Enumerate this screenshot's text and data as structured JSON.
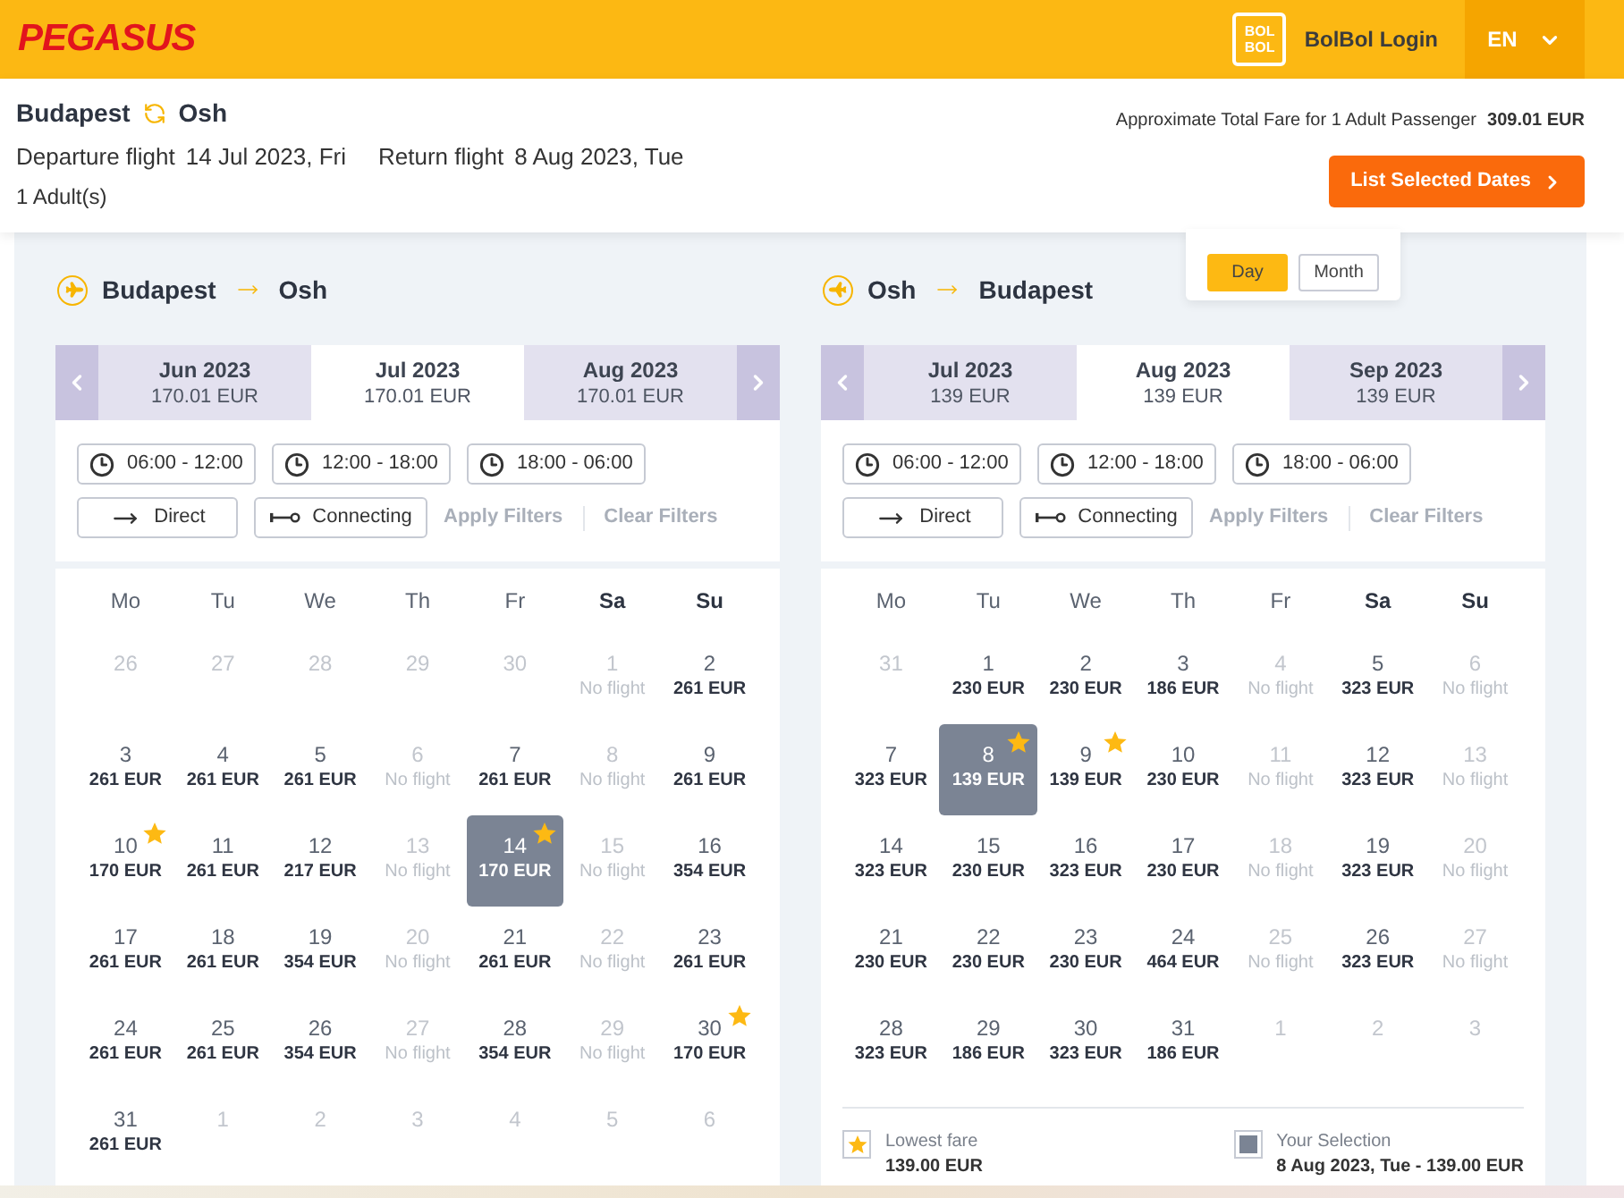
{
  "header": {
    "logo": "PEGASUS",
    "bolbol_badge": [
      "BOL",
      "BOL"
    ],
    "login": "BolBol Login",
    "language": "EN"
  },
  "summary": {
    "origin": "Budapest",
    "destination": "Osh",
    "departure_label": "Departure flight",
    "departure_date": "14 Jul 2023, Fri",
    "return_label": "Return flight",
    "return_date": "8 Aug 2023, Tue",
    "passengers": "1 Adult(s)",
    "fare_label": "Approximate Total Fare for 1 Adult Passenger",
    "fare_total": "309.01 EUR",
    "list_button": "List Selected Dates"
  },
  "view_toggle": [
    {
      "label": "Day",
      "selected": true
    },
    {
      "label": "Month",
      "selected": false
    }
  ],
  "legs": [
    {
      "kind": "outbound",
      "from": "Budapest",
      "to": "Osh",
      "months": [
        {
          "label": "Jun 2023",
          "price": "170.01 EUR",
          "selected": false
        },
        {
          "label": "Jul 2023",
          "price": "170.01 EUR",
          "selected": true
        },
        {
          "label": "Aug 2023",
          "price": "170.01 EUR",
          "selected": false
        }
      ],
      "time_filters": [
        "06:00 - 12:00",
        "12:00 - 18:00",
        "18:00 - 06:00"
      ],
      "stop_filters": [
        {
          "kind": "direct",
          "label": "Direct"
        },
        {
          "kind": "connecting",
          "label": "Connecting"
        }
      ],
      "actions": [
        {
          "label": "Apply Filters",
          "disabled": true
        },
        {
          "label": "Clear Filters",
          "disabled": true
        }
      ],
      "weekdays": [
        {
          "label": "Mo",
          "weekend": false
        },
        {
          "label": "Tu",
          "weekend": false
        },
        {
          "label": "We",
          "weekend": false
        },
        {
          "label": "Th",
          "weekend": false
        },
        {
          "label": "Fr",
          "weekend": false
        },
        {
          "label": "Sa",
          "weekend": true
        },
        {
          "label": "Su",
          "weekend": true
        }
      ],
      "days": [
        {
          "day": "26",
          "kind": "outside",
          "selected": false,
          "lowest": false
        },
        {
          "day": "27",
          "kind": "outside",
          "selected": false,
          "lowest": false
        },
        {
          "day": "28",
          "kind": "outside",
          "selected": false,
          "lowest": false
        },
        {
          "day": "29",
          "kind": "outside",
          "selected": false,
          "lowest": false
        },
        {
          "day": "30",
          "kind": "outside",
          "selected": false,
          "lowest": false
        },
        {
          "day": "1",
          "kind": "no-flight",
          "price": "No flight",
          "selected": false,
          "lowest": false
        },
        {
          "day": "2",
          "kind": "fare",
          "price": "261 EUR",
          "selected": false,
          "lowest": false
        },
        {
          "day": "3",
          "kind": "fare",
          "price": "261 EUR",
          "selected": false,
          "lowest": false
        },
        {
          "day": "4",
          "kind": "fare",
          "price": "261 EUR",
          "selected": false,
          "lowest": false
        },
        {
          "day": "5",
          "kind": "fare",
          "price": "261 EUR",
          "selected": false,
          "lowest": false
        },
        {
          "day": "6",
          "kind": "no-flight",
          "price": "No flight",
          "selected": false,
          "lowest": false
        },
        {
          "day": "7",
          "kind": "fare",
          "price": "261 EUR",
          "selected": false,
          "lowest": false
        },
        {
          "day": "8",
          "kind": "no-flight",
          "price": "No flight",
          "selected": false,
          "lowest": false
        },
        {
          "day": "9",
          "kind": "fare",
          "price": "261 EUR",
          "selected": false,
          "lowest": false
        },
        {
          "day": "10",
          "kind": "fare",
          "price": "170 EUR",
          "selected": false,
          "lowest": true
        },
        {
          "day": "11",
          "kind": "fare",
          "price": "261 EUR",
          "selected": false,
          "lowest": false
        },
        {
          "day": "12",
          "kind": "fare",
          "price": "217 EUR",
          "selected": false,
          "lowest": false
        },
        {
          "day": "13",
          "kind": "no-flight",
          "price": "No flight",
          "selected": false,
          "lowest": false
        },
        {
          "day": "14",
          "kind": "fare",
          "price": "170 EUR",
          "selected": true,
          "lowest": true
        },
        {
          "day": "15",
          "kind": "no-flight",
          "price": "No flight",
          "selected": false,
          "lowest": false
        },
        {
          "day": "16",
          "kind": "fare",
          "price": "354 EUR",
          "selected": false,
          "lowest": false
        },
        {
          "day": "17",
          "kind": "fare",
          "price": "261 EUR",
          "selected": false,
          "lowest": false
        },
        {
          "day": "18",
          "kind": "fare",
          "price": "261 EUR",
          "selected": false,
          "lowest": false
        },
        {
          "day": "19",
          "kind": "fare",
          "price": "354 EUR",
          "selected": false,
          "lowest": false
        },
        {
          "day": "20",
          "kind": "no-flight",
          "price": "No flight",
          "selected": false,
          "lowest": false
        },
        {
          "day": "21",
          "kind": "fare",
          "price": "261 EUR",
          "selected": false,
          "lowest": false
        },
        {
          "day": "22",
          "kind": "no-flight",
          "price": "No flight",
          "selected": false,
          "lowest": false
        },
        {
          "day": "23",
          "kind": "fare",
          "price": "261 EUR",
          "selected": false,
          "lowest": false
        },
        {
          "day": "24",
          "kind": "fare",
          "price": "261 EUR",
          "selected": false,
          "lowest": false
        },
        {
          "day": "25",
          "kind": "fare",
          "price": "261 EUR",
          "selected": false,
          "lowest": false
        },
        {
          "day": "26",
          "kind": "fare",
          "price": "354 EUR",
          "selected": false,
          "lowest": false
        },
        {
          "day": "27",
          "kind": "no-flight",
          "price": "No flight",
          "selected": false,
          "lowest": false
        },
        {
          "day": "28",
          "kind": "fare",
          "price": "354 EUR",
          "selected": false,
          "lowest": false
        },
        {
          "day": "29",
          "kind": "no-flight",
          "price": "No flight",
          "selected": false,
          "lowest": false
        },
        {
          "day": "30",
          "kind": "fare",
          "price": "170 EUR",
          "selected": false,
          "lowest": true
        },
        {
          "day": "31",
          "kind": "fare",
          "price": "261 EUR",
          "selected": false,
          "lowest": false
        },
        {
          "day": "1",
          "kind": "outside",
          "selected": false,
          "lowest": false
        },
        {
          "day": "2",
          "kind": "outside",
          "selected": false,
          "lowest": false
        },
        {
          "day": "3",
          "kind": "outside",
          "selected": false,
          "lowest": false
        },
        {
          "day": "4",
          "kind": "outside",
          "selected": false,
          "lowest": false
        },
        {
          "day": "5",
          "kind": "outside",
          "selected": false,
          "lowest": false
        },
        {
          "day": "6",
          "kind": "outside",
          "selected": false,
          "lowest": false
        }
      ]
    },
    {
      "kind": "return",
      "from": "Osh",
      "to": "Budapest",
      "months": [
        {
          "label": "Jul 2023",
          "price": "139 EUR",
          "selected": false
        },
        {
          "label": "Aug 2023",
          "price": "139 EUR",
          "selected": true
        },
        {
          "label": "Sep 2023",
          "price": "139 EUR",
          "selected": false
        }
      ],
      "time_filters": [
        "06:00 - 12:00",
        "12:00 - 18:00",
        "18:00 - 06:00"
      ],
      "stop_filters": [
        {
          "kind": "direct",
          "label": "Direct"
        },
        {
          "kind": "connecting",
          "label": "Connecting"
        }
      ],
      "actions": [
        {
          "label": "Apply Filters",
          "disabled": true
        },
        {
          "label": "Clear Filters",
          "disabled": true
        }
      ],
      "weekdays": [
        {
          "label": "Mo",
          "weekend": false
        },
        {
          "label": "Tu",
          "weekend": false
        },
        {
          "label": "We",
          "weekend": false
        },
        {
          "label": "Th",
          "weekend": false
        },
        {
          "label": "Fr",
          "weekend": false
        },
        {
          "label": "Sa",
          "weekend": true
        },
        {
          "label": "Su",
          "weekend": true
        }
      ],
      "days": [
        {
          "day": "31",
          "kind": "outside",
          "selected": false,
          "lowest": false
        },
        {
          "day": "1",
          "kind": "fare",
          "price": "230 EUR",
          "selected": false,
          "lowest": false
        },
        {
          "day": "2",
          "kind": "fare",
          "price": "230 EUR",
          "selected": false,
          "lowest": false
        },
        {
          "day": "3",
          "kind": "fare",
          "price": "186 EUR",
          "selected": false,
          "lowest": false
        },
        {
          "day": "4",
          "kind": "no-flight",
          "price": "No flight",
          "selected": false,
          "lowest": false
        },
        {
          "day": "5",
          "kind": "fare",
          "price": "323 EUR",
          "selected": false,
          "lowest": false
        },
        {
          "day": "6",
          "kind": "no-flight",
          "price": "No flight",
          "selected": false,
          "lowest": false
        },
        {
          "day": "7",
          "kind": "fare",
          "price": "323 EUR",
          "selected": false,
          "lowest": false
        },
        {
          "day": "8",
          "kind": "fare",
          "price": "139 EUR",
          "selected": true,
          "lowest": true
        },
        {
          "day": "9",
          "kind": "fare",
          "price": "139 EUR",
          "selected": false,
          "lowest": true
        },
        {
          "day": "10",
          "kind": "fare",
          "price": "230 EUR",
          "selected": false,
          "lowest": false
        },
        {
          "day": "11",
          "kind": "no-flight",
          "price": "No flight",
          "selected": false,
          "lowest": false
        },
        {
          "day": "12",
          "kind": "fare",
          "price": "323 EUR",
          "selected": false,
          "lowest": false
        },
        {
          "day": "13",
          "kind": "no-flight",
          "price": "No flight",
          "selected": false,
          "lowest": false
        },
        {
          "day": "14",
          "kind": "fare",
          "price": "323 EUR",
          "selected": false,
          "lowest": false
        },
        {
          "day": "15",
          "kind": "fare",
          "price": "230 EUR",
          "selected": false,
          "lowest": false
        },
        {
          "day": "16",
          "kind": "fare",
          "price": "323 EUR",
          "selected": false,
          "lowest": false
        },
        {
          "day": "17",
          "kind": "fare",
          "price": "230 EUR",
          "selected": false,
          "lowest": false
        },
        {
          "day": "18",
          "kind": "no-flight",
          "price": "No flight",
          "selected": false,
          "lowest": false
        },
        {
          "day": "19",
          "kind": "fare",
          "price": "323 EUR",
          "selected": false,
          "lowest": false
        },
        {
          "day": "20",
          "kind": "no-flight",
          "price": "No flight",
          "selected": false,
          "lowest": false
        },
        {
          "day": "21",
          "kind": "fare",
          "price": "230 EUR",
          "selected": false,
          "lowest": false
        },
        {
          "day": "22",
          "kind": "fare",
          "price": "230 EUR",
          "selected": false,
          "lowest": false
        },
        {
          "day": "23",
          "kind": "fare",
          "price": "230 EUR",
          "selected": false,
          "lowest": false
        },
        {
          "day": "24",
          "kind": "fare",
          "price": "464 EUR",
          "selected": false,
          "lowest": false
        },
        {
          "day": "25",
          "kind": "no-flight",
          "price": "No flight",
          "selected": false,
          "lowest": false
        },
        {
          "day": "26",
          "kind": "fare",
          "price": "323 EUR",
          "selected": false,
          "lowest": false
        },
        {
          "day": "27",
          "kind": "no-flight",
          "price": "No flight",
          "selected": false,
          "lowest": false
        },
        {
          "day": "28",
          "kind": "fare",
          "price": "323 EUR",
          "selected": false,
          "lowest": false
        },
        {
          "day": "29",
          "kind": "fare",
          "price": "186 EUR",
          "selected": false,
          "lowest": false
        },
        {
          "day": "30",
          "kind": "fare",
          "price": "323 EUR",
          "selected": false,
          "lowest": false
        },
        {
          "day": "31",
          "kind": "fare",
          "price": "186 EUR",
          "selected": false,
          "lowest": false
        },
        {
          "day": "1",
          "kind": "outside",
          "selected": false,
          "lowest": false
        },
        {
          "day": "2",
          "kind": "outside",
          "selected": false,
          "lowest": false
        },
        {
          "day": "3",
          "kind": "outside",
          "selected": false,
          "lowest": false
        }
      ],
      "legend": [
        {
          "kind": "lowest",
          "label": "Lowest fare",
          "value": "139.00 EUR"
        },
        {
          "kind": "selection",
          "label": "Your Selection",
          "value": "8 Aug 2023, Tue - 139.00 EUR"
        }
      ]
    }
  ]
}
